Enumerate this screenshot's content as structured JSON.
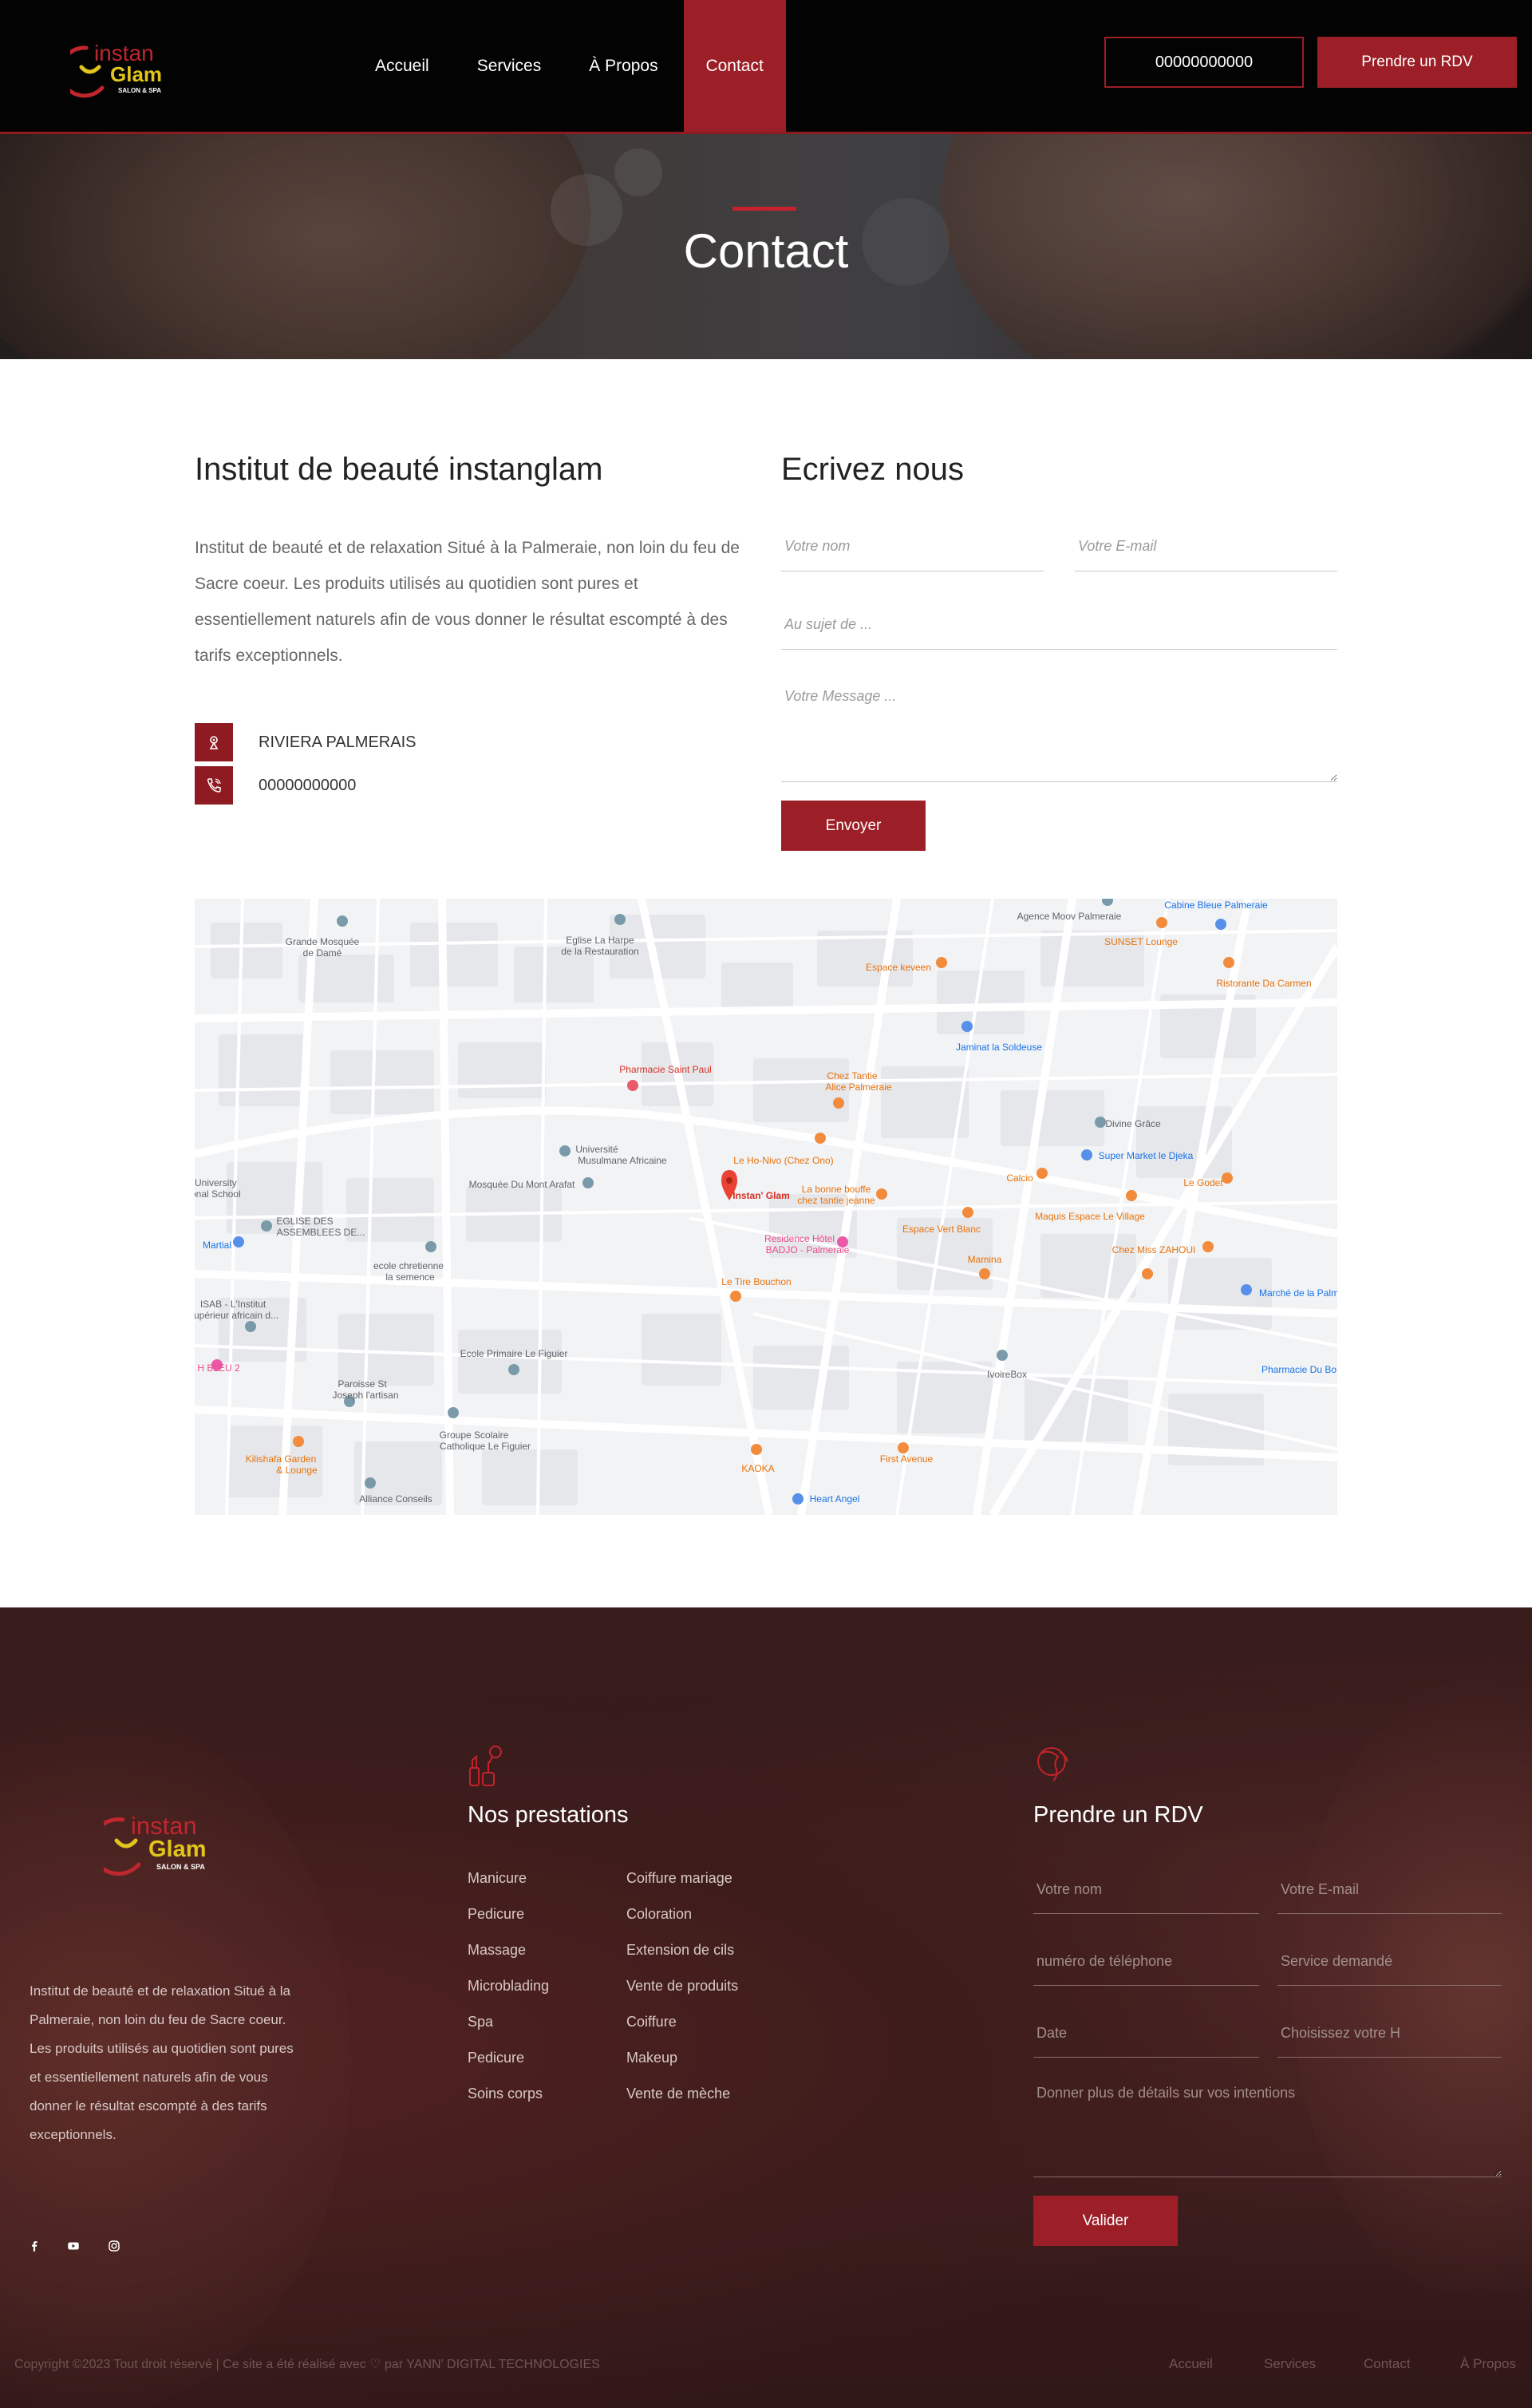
{
  "header": {
    "logo_line1": "instan",
    "logo_line2": "Glam",
    "logo_sub": "SALON & SPA",
    "nav": [
      {
        "label": "Accueil"
      },
      {
        "label": "Services"
      },
      {
        "label": "À Propos"
      },
      {
        "label": "Contact",
        "active": true
      }
    ],
    "phone": "00000000000",
    "cta": "Prendre un RDV"
  },
  "hero": {
    "title": "Contact"
  },
  "info": {
    "title": "Institut de beauté instanglam",
    "description": "Institut de beauté et de relaxation Situé à la Palmeraie, non loin du feu de Sacre coeur. Les produits utilisés au quotidien sont pures et essentiellement naturels afin de vous donner le résultat escompté à des tarifs exceptionnels.",
    "address": "RIVIERA PALMERAIS",
    "phone": "00000000000"
  },
  "form": {
    "title": "Ecrivez nous",
    "name_placeholder": "Votre nom",
    "email_placeholder": "Votre E-mail",
    "subject_placeholder": "Au sujet de ...",
    "message_placeholder": "Votre Message ...",
    "submit": "Envoyer"
  },
  "map": {
    "labels": [
      "Grande Mosquée de Damé",
      "Eglise La Harpe de la Restauration",
      "Agence Moov Palmeraie",
      "Cabine Bleue Palmeraie",
      "SUNSET Lounge",
      "Ristorante Da Carmen",
      "Espace keveen",
      "Jaminat la Soldeuse",
      "Pharmacie Saint Paul",
      "Chez Tantie Alice Palmeraie",
      "Divine Grâce",
      "Université Musulmane Africaine",
      "Le Ho-Nivo (Chez Ono)",
      "Super Market le Djeka",
      "Mosquée Du Mont Arafat",
      "Instan' Glam",
      "La bonne bouffe chez tantie jeanne",
      "Calcio",
      "Le Godet",
      "Maquis Espace Le Village",
      "EGLISE DES ASSEMBLEES DE...",
      "Residence Hôtel BADJO - Palmeraie",
      "Espace Vert Blanc",
      "Chez Miss ZAHOUI",
      "ecole chretienne la semence",
      "Mamina",
      "Le Tire Bouchon",
      "Marché de la Palm",
      "ISAB - L'Institut Supérieur africain d...",
      "Ecole Primaire Le Figuier",
      "IvoireBox",
      "Pharmacie Du Bo",
      "Paroisse St Joseph l'artisan",
      "Groupe Scolaire Catholique Le Figuier",
      "First Avenue",
      "Kilishafa Garden & Lounge",
      "KAOKA",
      "Alliance Conseils",
      "Heart Angel",
      "Martial",
      "al University ational School",
      "H BLEU 2"
    ]
  },
  "footer": {
    "logo_line1": "instan",
    "logo_line2": "Glam",
    "logo_sub": "SALON & SPA",
    "about": "Institut de beauté et de relaxation Situé à la Palmeraie, non loin du feu de Sacre coeur. Les produits utilisés au quotidien sont pures et essentiellement naturels afin de vous donner le résultat escompté à des tarifs exceptionnels.",
    "social": [
      "facebook-icon",
      "youtube-icon",
      "instagram-icon"
    ],
    "services_title": "Nos prestations",
    "services_col1": [
      "Manicure",
      "Pedicure",
      "Massage",
      "Microblading",
      "Spa",
      "Pedicure",
      "Soins corps"
    ],
    "services_col2": [
      "Coiffure mariage",
      "Coloration",
      "Extension de cils",
      "Vente de produits",
      "Coiffure",
      "Makeup",
      "Vente de mèche"
    ],
    "rdv_title": "Prendre un RDV",
    "rdv_form": {
      "name": "Votre nom",
      "email": "Votre E-mail",
      "phone": "numéro de téléphone",
      "service": "Service demandé",
      "date": "Date",
      "hour": "Choisissez votre H",
      "details": "Donner plus de détails sur vos intentions",
      "submit": "Valider"
    },
    "copyright": "Copyright ©2023 Tout droit réservé | Ce site a été réalisé avec ♡ par YANN' DIGITAL TECHNOLOGIES",
    "nav": [
      "Accueil",
      "Services",
      "Contact",
      "À Propos"
    ]
  },
  "colors": {
    "brand_red": "#9c1f27",
    "logo_yellow": "#e1c51c",
    "header_bg": "#030303",
    "footer_bg": "#3f2223"
  }
}
